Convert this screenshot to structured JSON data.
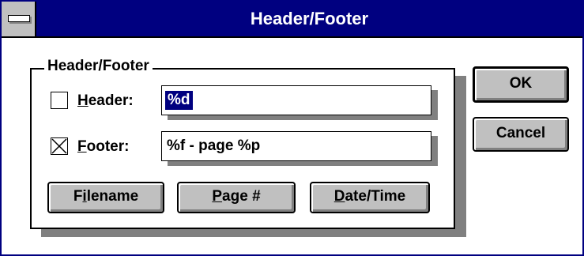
{
  "window": {
    "title": "Header/Footer"
  },
  "group": {
    "label": "Header/Footer"
  },
  "header_row": {
    "checked": false,
    "label_accel": "H",
    "label_rest": "eader:",
    "value": "%d"
  },
  "footer_row": {
    "checked": true,
    "label_accel": "F",
    "label_rest": "ooter:",
    "value": "%f - page %p"
  },
  "insert_buttons": {
    "filename_pre": "F",
    "filename_accel": "i",
    "filename_post": "lename",
    "page_accel": "P",
    "page_post": "age #",
    "datetime_accel": "D",
    "datetime_post": "ate/Time"
  },
  "actions": {
    "ok_label": "OK",
    "cancel_label": "Cancel"
  },
  "colors": {
    "titlebar": "#000080",
    "face": "#c0c0c0",
    "shadow": "#808080",
    "selection": "#000080"
  }
}
